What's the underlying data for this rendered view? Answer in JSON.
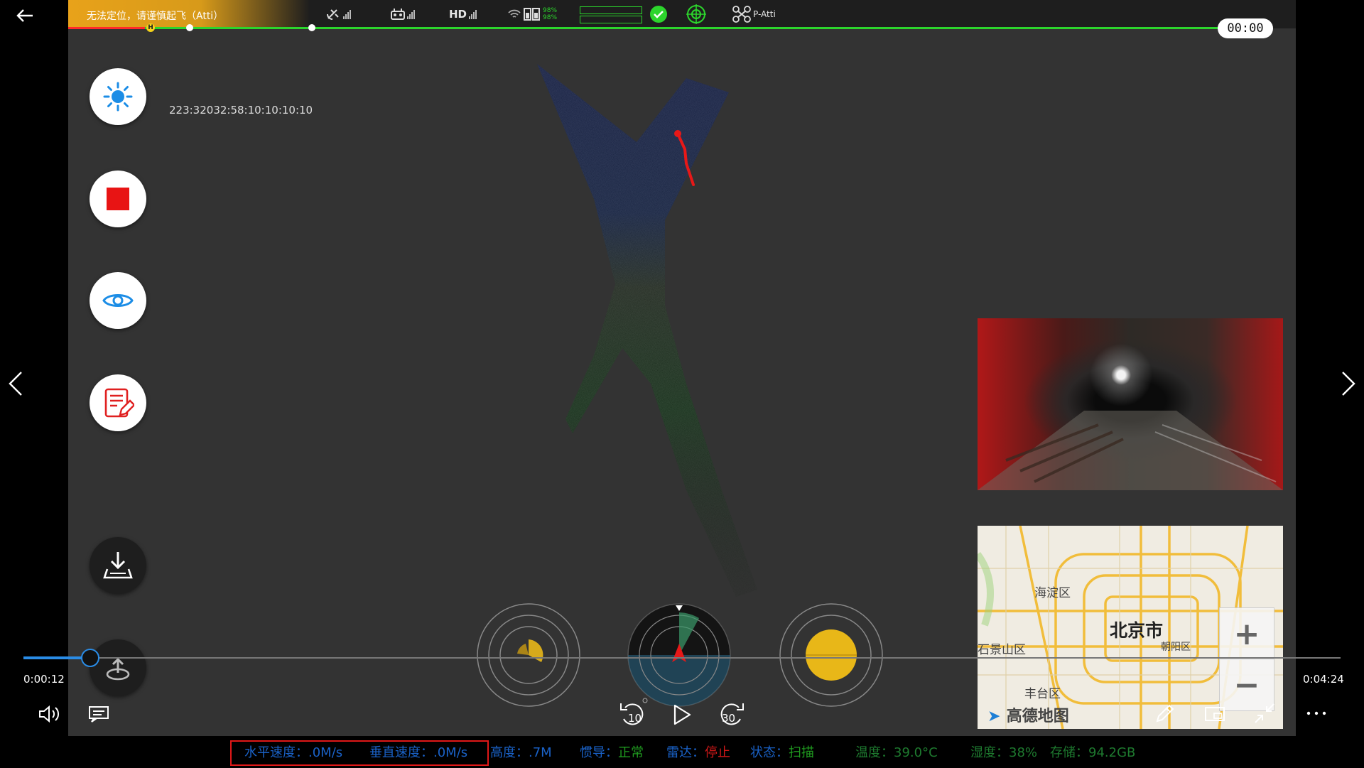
{
  "header": {
    "warning": "无法定位，请谨慎起飞（Atti）",
    "home_marker": "H",
    "hd_label": "HD",
    "battery_1": "98%",
    "battery_2": "98%",
    "flight_mode": "P-Atti",
    "timer": "00:00"
  },
  "readout": {
    "coordinates": "223:32032:58:10:10:10:10"
  },
  "playback": {
    "current_time": "0:00:12",
    "total_time": "0:04:24",
    "progress": 0.045,
    "rewind_label": "10",
    "forward_label": "30"
  },
  "map": {
    "city": "北京市",
    "district_1": "海淀区",
    "district_2": "石景山区",
    "district_3": "朝阳区",
    "district_4": "丰台区",
    "brand": "高德地图",
    "zoom_in": "+",
    "zoom_out": "−"
  },
  "telemetry": {
    "h_speed_label": "水平速度：",
    "h_speed_value": ".0M/s",
    "v_speed_label": "垂直速度：",
    "v_speed_value": ".0M/s",
    "height_label": "高度：",
    "height_value": ".7M",
    "ins_label": "惯导：",
    "ins_value": "正常",
    "radar_label": "雷达：",
    "radar_value": "停止",
    "state_label": "状态：",
    "state_value": "扫描",
    "temp_label": "温度：",
    "temp_value": "39.0°C",
    "humidity_label": "湿度：",
    "humidity_value": "38%",
    "storage_label": "存储：",
    "storage_value": "94.2GB"
  },
  "colors": {
    "accent": "#2a8ce6",
    "ok": "#2cd52c",
    "warning": "#e8a21a",
    "alert": "#e01818",
    "gauge_yellow": "#e8b718"
  },
  "icons": {
    "back": "arrow-left-icon",
    "prev": "chevron-left-icon",
    "next": "chevron-right-icon",
    "brightness": "sun-icon",
    "record": "stop-square-icon",
    "view": "eye-icon",
    "notes": "note-edit-icon",
    "download": "download-icon",
    "return_home": "return-home-icon",
    "volume": "volume-icon",
    "subtitles": "subtitles-icon",
    "pen": "pen-icon",
    "pip": "picture-in-picture-icon",
    "exit_fullscreen": "collapse-icon",
    "more": "more-icon"
  }
}
